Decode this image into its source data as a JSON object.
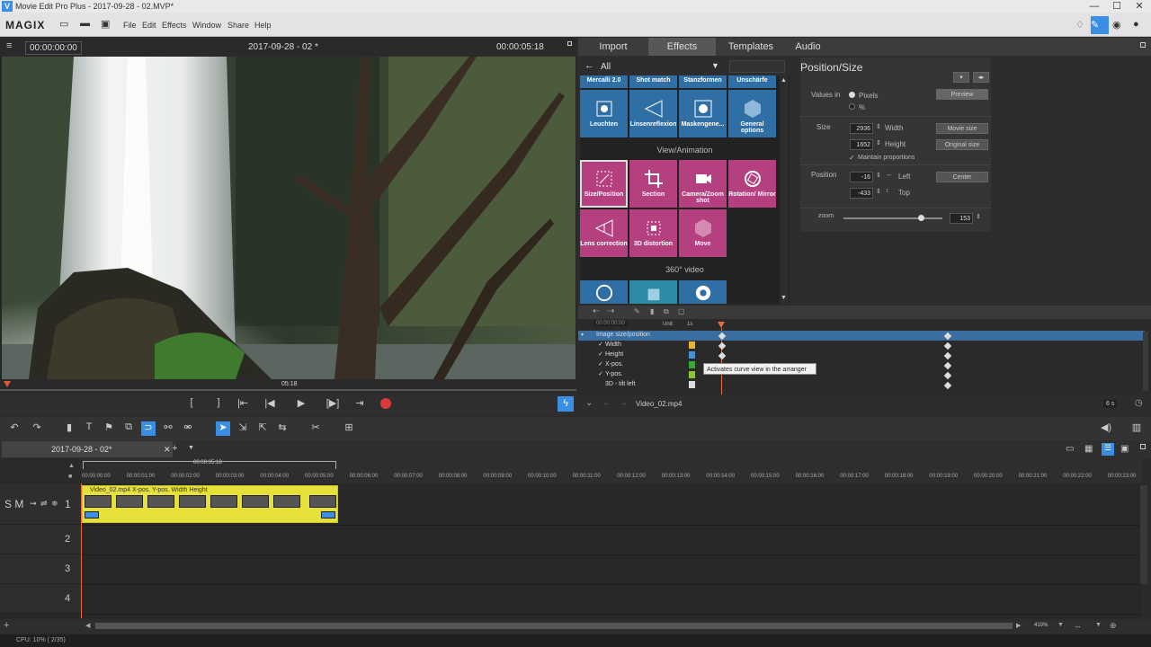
{
  "window": {
    "title": "Movie Edit Pro Plus - 2017-09-28 - 02.MVP*",
    "logo_letter": "V",
    "min": "—",
    "max": "☐",
    "close": "✕"
  },
  "menubar": {
    "brand": "MAGIX",
    "items": [
      "File",
      "Edit",
      "Effects",
      "Window",
      "Share",
      "Help"
    ]
  },
  "preview": {
    "timecode_left": "00:00:00:00",
    "title": "2017-09-28 - 02 *",
    "timecode_right": "00:00:05:18",
    "scrub_label": "05:18"
  },
  "tabs": {
    "import": "Import",
    "effects": "Effects",
    "templates": "Templates",
    "audio": "Audio"
  },
  "effects": {
    "filter": "All",
    "top_row": [
      "Mercalli 2.0",
      "Shot match",
      "Stanzformen",
      "Unschärfe"
    ],
    "tiles_row1": [
      "Leuchten",
      "Linsenreflexion",
      "Maskengene...",
      "General options"
    ],
    "section_view": "View/Animation",
    "tiles_row2": [
      "Size/Position",
      "Section",
      "Camera/Zoom shot",
      "Rotation/ Mirror"
    ],
    "tiles_row3": [
      "Lens correction",
      "3D distortion",
      "Move"
    ],
    "section_360": "360° video"
  },
  "props": {
    "title": "Position/Size",
    "values_in": "Values in",
    "pixels": "Pixels",
    "percent": "%",
    "preview_btn": "Preview",
    "size": "Size",
    "width_val": "2936",
    "width_lbl": "Width",
    "movie_size": "Movie size",
    "height_val": "1652",
    "height_lbl": "Height",
    "original_size": "Original size",
    "maintain": "Maintain proportions",
    "position": "Position",
    "left_val": "-16",
    "left_lbl": "Left",
    "center": "Center",
    "top_val": "-433",
    "top_lbl": "Top",
    "zoom": "zoom",
    "zoom_val": "153",
    "zoom_level": 0.78
  },
  "keyframes": {
    "timecode": "00:00:00:00",
    "unit_label": "Unit:",
    "unit_val": "1s",
    "rows": [
      "Image size/position",
      "Width",
      "Height",
      "X-pos.",
      "Y-pos.",
      "3D - tilt left"
    ],
    "tooltip": "Activates curve view in the arranger",
    "clip_name": "Video_02.mp4",
    "duration": "6 s"
  },
  "arranger": {
    "project_tab": "2017-09-28 - 02*",
    "playhead": "00:00:05:18",
    "ruler": [
      "00:00:00:00",
      "00:00:01:00",
      "00:00:02:00",
      "00:00:03:00",
      "00:00:04:00",
      "00:00:05:00",
      "00:00:06:00",
      "00:00:07:00",
      "00:00:08:00",
      "00:00:09:00",
      "00:00:10:00",
      "00:00:11:00",
      "00:00:12:00",
      "00:00:13:00",
      "00:00:14:00",
      "00:00:15:00",
      "00:00:16:00",
      "00:00:17:00",
      "00:00:18:00",
      "00:00:19:00",
      "00:00:20:00",
      "00:00:21:00",
      "00:00:22:00",
      "00:00:23:00"
    ],
    "track_numbers": [
      "1",
      "2",
      "3",
      "4"
    ],
    "track1_controls": "S M",
    "clip_caption": "Video_02.mp4 X-pos. Y-pos. Width Height",
    "zoom_pct": "410%"
  },
  "status": "CPU: 10% ( 2/35)"
}
